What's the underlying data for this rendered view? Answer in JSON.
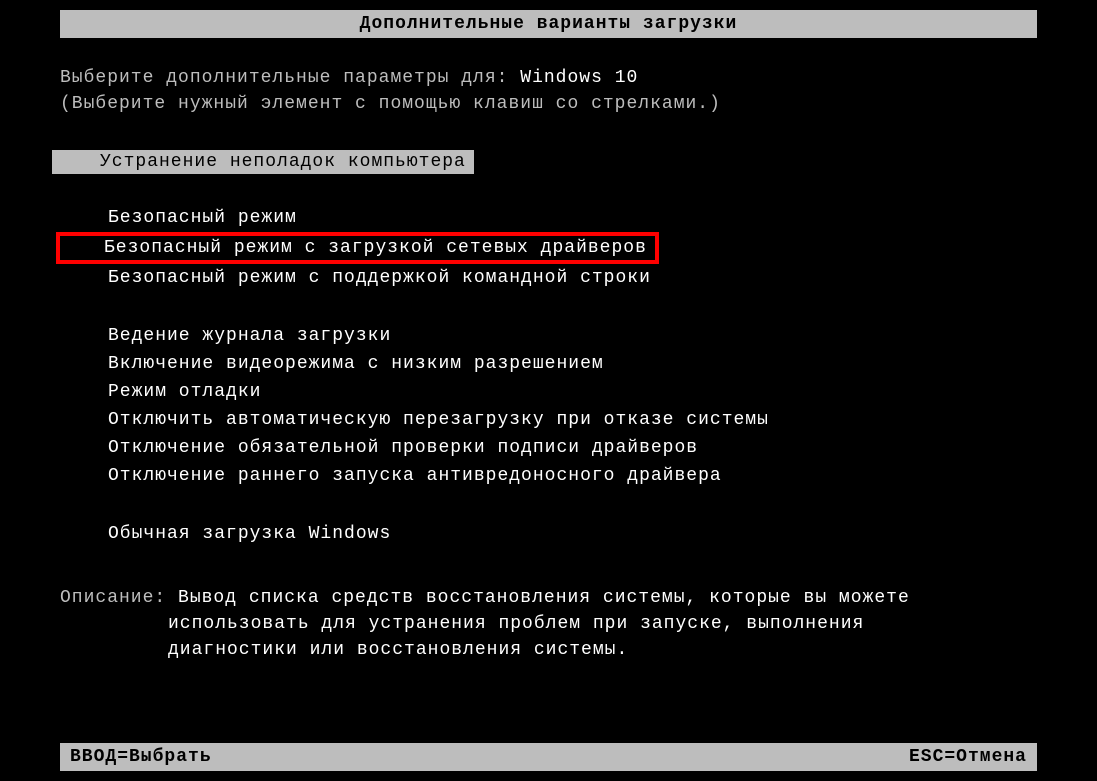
{
  "header": {
    "title": "Дополнительные варианты загрузки"
  },
  "prompt": {
    "text": "Выберите дополнительные параметры для:",
    "os": "Windows 10"
  },
  "instruction": "(Выберите нужный элемент с помощью клавиш со стрелками.)",
  "menu": {
    "selected": "Устранение неполадок компьютера",
    "group1": {
      "item1": "Безопасный режим",
      "item2": "Безопасный режим с загрузкой сетевых драйверов",
      "item3": "Безопасный режим с поддержкой командной строки"
    },
    "group2": {
      "item1": "Ведение журнала загрузки",
      "item2": "Включение видеорежима с низким разрешением",
      "item3": "Режим отладки",
      "item4": "Отключить автоматическую перезагрузку при отказе системы",
      "item5": "Отключение обязательной проверки подписи драйверов",
      "item6": "Отключение раннего запуска антивредоносного драйвера"
    },
    "group3": {
      "item1": "Обычная загрузка Windows"
    }
  },
  "description": {
    "label": "Описание:",
    "line1": "Вывод списка средств восстановления системы, которые вы можете",
    "line2": "использовать для устранения проблем при запуске, выполнения",
    "line3": "диагностики или восстановления системы."
  },
  "footer": {
    "enter": "ВВОД=Выбрать",
    "esc": "ESC=Отмена"
  }
}
